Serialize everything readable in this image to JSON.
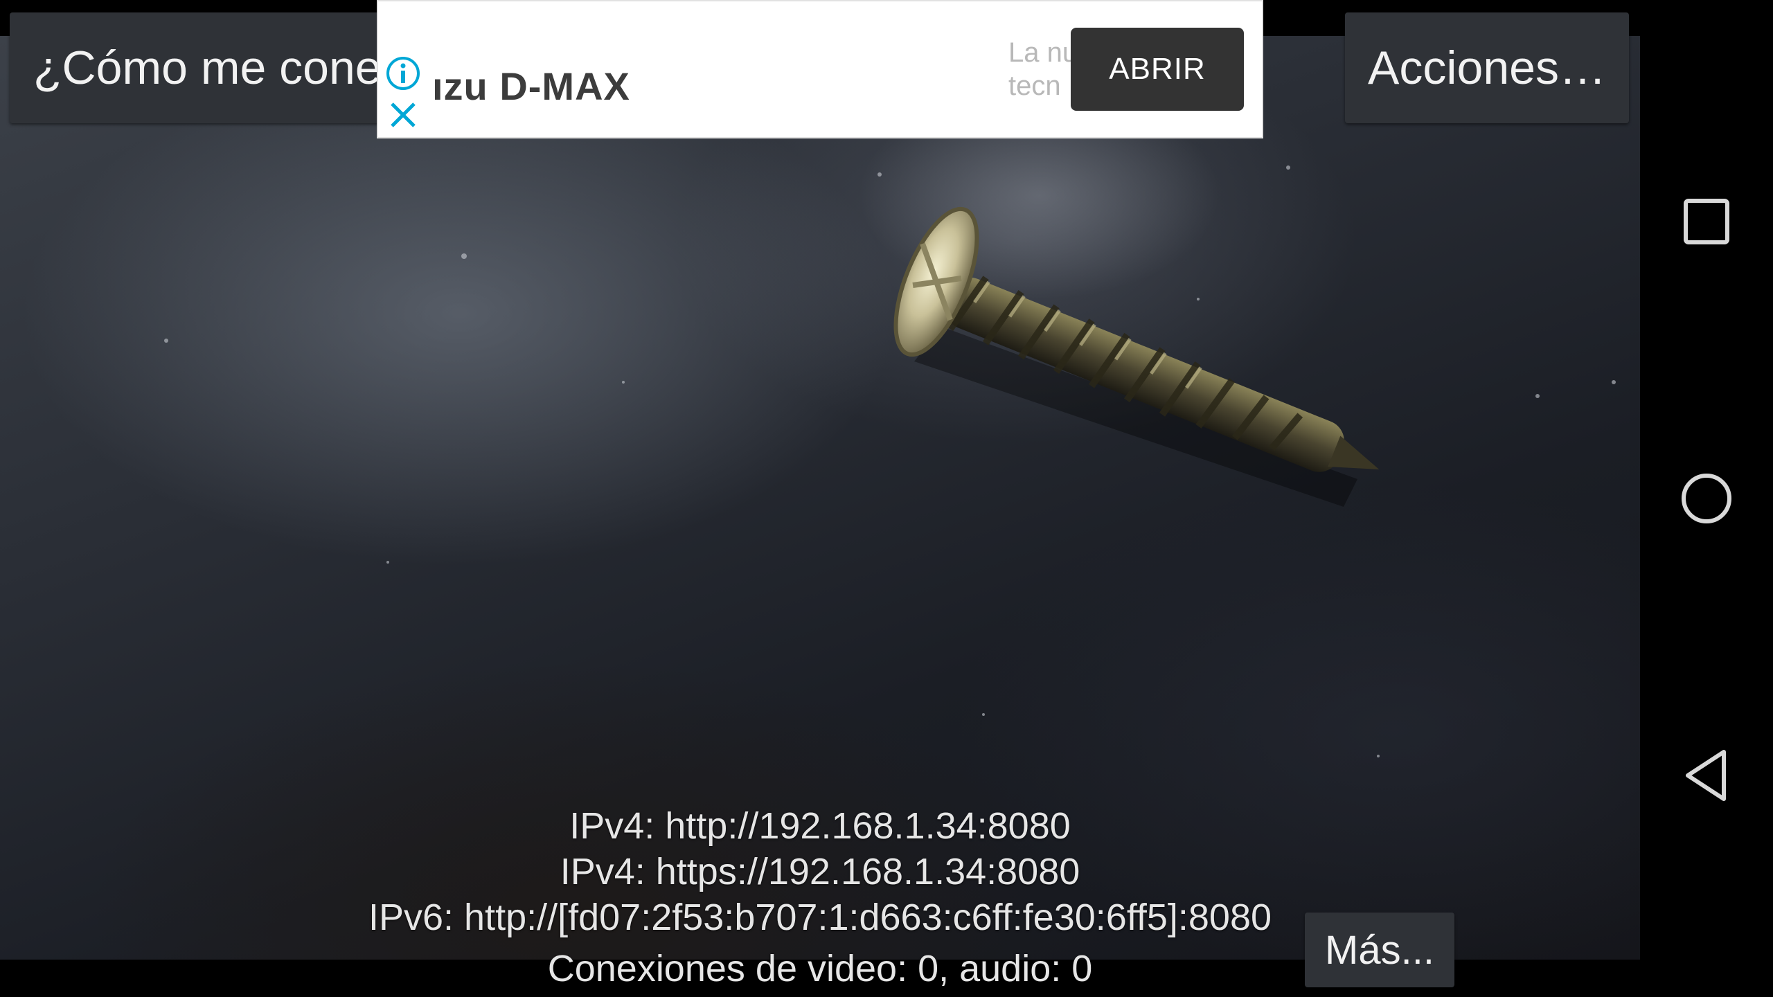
{
  "toolbar": {
    "help_label": "¿Cómo me cone",
    "actions_label": "Acciones…"
  },
  "ad": {
    "headline": "ızu D-MAX",
    "body_line1": "La nu",
    "body_line2": "tecn",
    "open_label": "ABRIR",
    "info_icon": "info-icon",
    "close_icon": "close-icon",
    "accent_color": "#00a7d6"
  },
  "server": {
    "ipv4_http": "IPv4: http://192.168.1.34:8080",
    "ipv4_https": "IPv4: https://192.168.1.34:8080",
    "ipv6_http": "IPv6: http://[fd07:2f53:b707:1:d663:c6ff:fe30:6ff5]:8080",
    "connections": "Conexiones de video: 0, audio: 0"
  },
  "more_label": "Más...",
  "nav": {
    "recents_icon": "square-recents-icon",
    "home_icon": "circle-home-icon",
    "back_icon": "triangle-back-icon"
  }
}
